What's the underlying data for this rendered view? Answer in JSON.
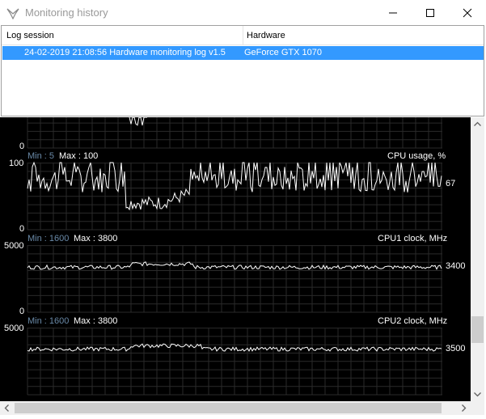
{
  "window": {
    "title": "Monitoring history",
    "controls": [
      "minimize-icon",
      "maximize-icon",
      "close-icon"
    ]
  },
  "log_table": {
    "columns": [
      "Log session",
      "Hardware"
    ],
    "rows": [
      {
        "session": "24-02-2019 21:08:56 Hardware monitoring log v1.5",
        "hardware": "GeForce GTX 1070",
        "selected": true
      }
    ]
  },
  "graphs": [
    {
      "name": "",
      "min_label": "",
      "max_label": "",
      "ymax_label": "",
      "ymin_label": "0",
      "current": ""
    },
    {
      "name": "CPU usage, %",
      "min_label": "Min : 5",
      "max_label": "Max : 100",
      "ymax_label": "100",
      "ymin_label": "0",
      "current": "67"
    },
    {
      "name": "CPU1 clock, MHz",
      "min_label": "Min : 1600",
      "max_label": "Max : 3800",
      "ymax_label": "5000",
      "ymin_label": "0",
      "current": "3400"
    },
    {
      "name": "CPU2 clock, MHz",
      "min_label": "Min : 1600",
      "max_label": "Max : 3800",
      "ymax_label": "5000",
      "ymin_label": "",
      "current": "3500"
    }
  ],
  "colors": {
    "selection": "#3399ff",
    "graph_bg": "#000000",
    "grid": "#2a2a2a",
    "trace": "#ffffff",
    "min_label": "#6a8aa8"
  }
}
